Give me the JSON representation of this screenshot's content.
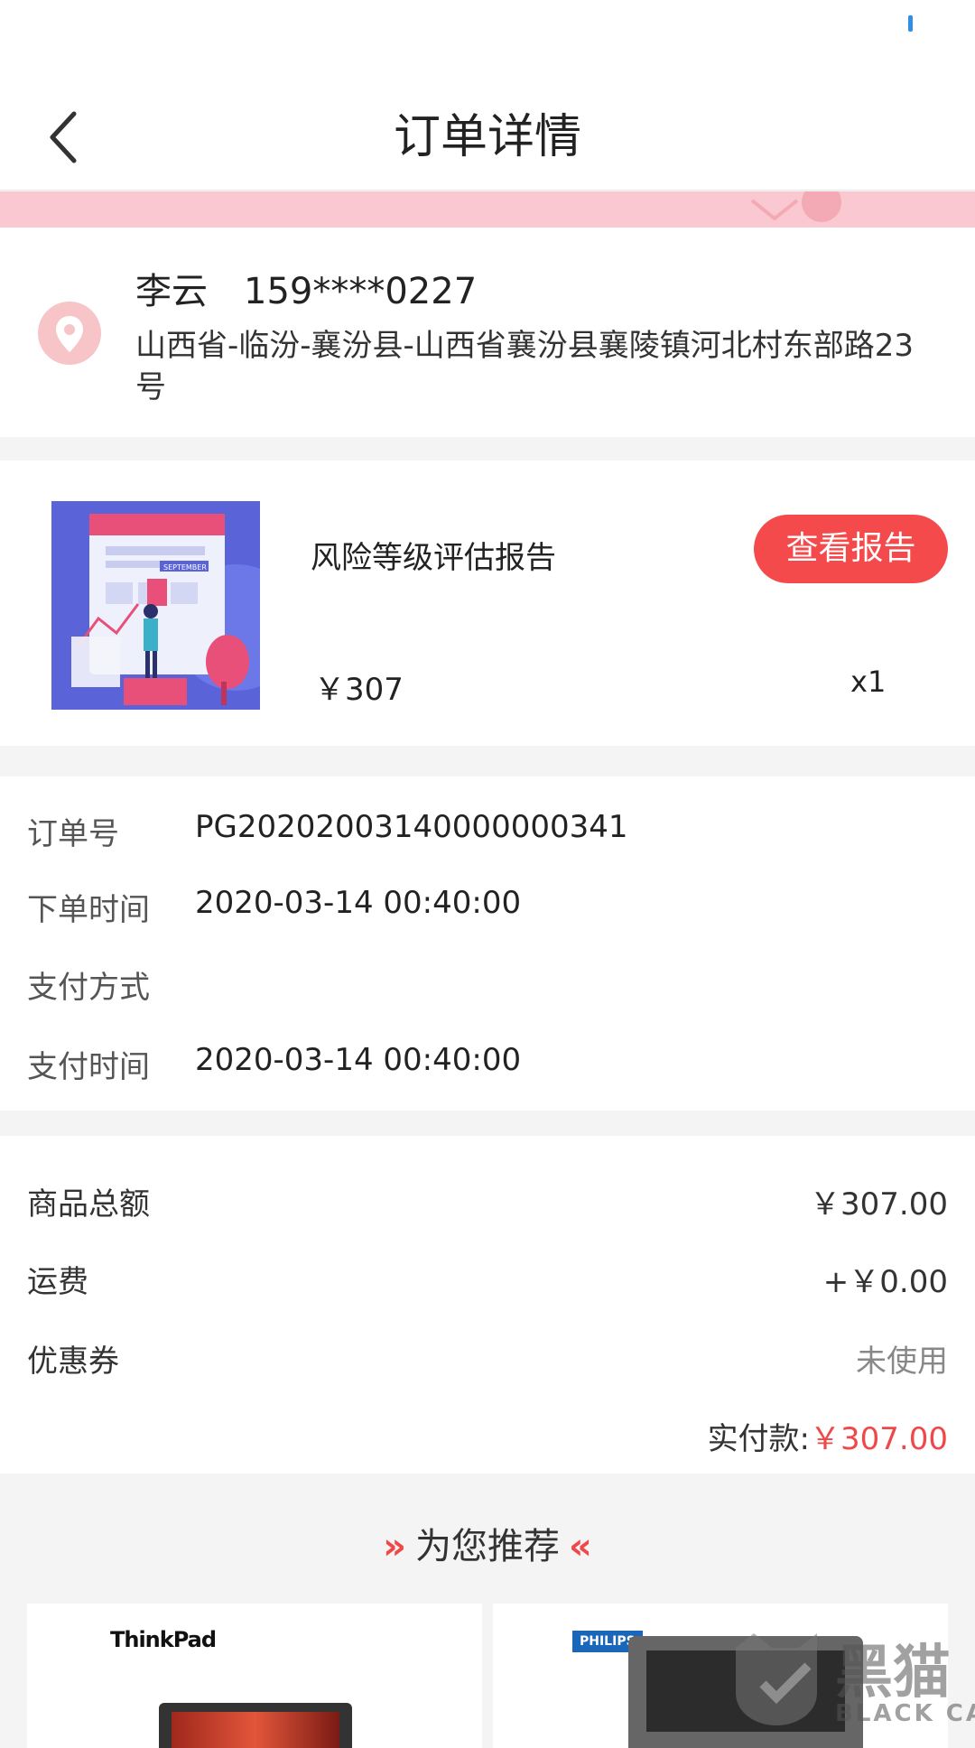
{
  "header": {
    "title": "订单详情"
  },
  "address": {
    "name": "李云",
    "phone": "159****0227",
    "full_address": "山西省-临汾-襄汾县-山西省襄汾县襄陵镇河北村东部路23号"
  },
  "product": {
    "name": "风险等级评估报告",
    "price": "￥307",
    "quantity": "x1",
    "action_label": "查看报告",
    "image_text": "SEPTEMBER"
  },
  "order_info": {
    "order_no_label": "订单号",
    "order_no": "PG20202003140000000341",
    "order_time_label": "下单时间",
    "order_time": "2020-03-14 00:40:00",
    "pay_method_label": "支付方式",
    "pay_method": "",
    "pay_time_label": "支付时间",
    "pay_time": "2020-03-14 00:40:00"
  },
  "amounts": {
    "subtotal_label": "商品总额",
    "subtotal": "￥307.00",
    "shipping_label": "运费",
    "shipping": "+￥0.00",
    "coupon_label": "优惠券",
    "coupon": "未使用",
    "paid_label": "实付款:",
    "paid": "￥307.00"
  },
  "recommend": {
    "title": "为您推荐",
    "items": [
      {
        "brand": "ThinkPad"
      },
      {
        "brand": "PHILIPS"
      }
    ]
  },
  "watermark": {
    "cn": "黑猫",
    "en": "BLACK CAT"
  },
  "colors": {
    "accent": "#f44a4c",
    "band": "#f9c8d0",
    "location_icon": "#f7c4c8"
  },
  "icons": [
    "back-arrow-icon",
    "location-pin-icon",
    "double-chevron-right-icon",
    "double-chevron-left-icon"
  ]
}
